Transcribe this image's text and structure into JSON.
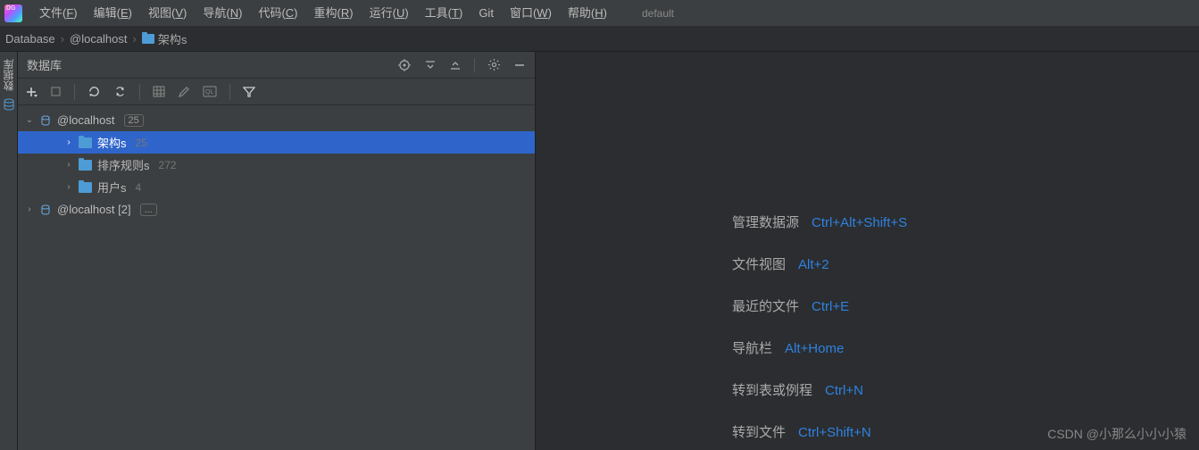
{
  "app": {
    "icon_label": "DG"
  },
  "menu": [
    {
      "label": "文件",
      "key": "F"
    },
    {
      "label": "编辑",
      "key": "E"
    },
    {
      "label": "视图",
      "key": "V"
    },
    {
      "label": "导航",
      "key": "N"
    },
    {
      "label": "代码",
      "key": "C"
    },
    {
      "label": "重构",
      "key": "R"
    },
    {
      "label": "运行",
      "key": "U"
    },
    {
      "label": "工具",
      "key": "T"
    },
    {
      "label": "Git",
      "key": ""
    },
    {
      "label": "窗口",
      "key": "W"
    },
    {
      "label": "帮助",
      "key": "H"
    }
  ],
  "default_label": "default",
  "breadcrumb": {
    "root": "Database",
    "host": "@localhost",
    "folder": "架构s"
  },
  "side_tab": {
    "label": "数据库"
  },
  "panel": {
    "title": "数据库",
    "header_icons": [
      "target-icon",
      "expand-down-icon",
      "collapse-up-icon",
      "gear-icon",
      "minimize-icon"
    ],
    "toolbar_icons": [
      "add-icon",
      "stop-icon",
      "refresh-icon",
      "sync-icon",
      "table-icon",
      "edit-icon",
      "console-icon",
      "filter-icon"
    ]
  },
  "tree": [
    {
      "expanded": true,
      "depth": 0,
      "icon": "db",
      "label": "@localhost",
      "badge": "25"
    },
    {
      "expanded": false,
      "depth": 1,
      "icon": "folder",
      "label": "架构s",
      "count": "25",
      "selected": true
    },
    {
      "expanded": false,
      "depth": 1,
      "icon": "folder",
      "label": "排序规则s",
      "count": "272"
    },
    {
      "expanded": false,
      "depth": 1,
      "icon": "folder",
      "label": "用户s",
      "count": "4"
    },
    {
      "expanded": false,
      "depth": 0,
      "icon": "db",
      "label": "@localhost [2]",
      "ellipsis": "..."
    }
  ],
  "shortcuts": [
    {
      "label": "管理数据源",
      "key": "Ctrl+Alt+Shift+S"
    },
    {
      "label": "文件视图",
      "key": "Alt+2"
    },
    {
      "label": "最近的文件",
      "key": "Ctrl+E"
    },
    {
      "label": "导航栏",
      "key": "Alt+Home"
    },
    {
      "label": "转到表或例程",
      "key": "Ctrl+N"
    },
    {
      "label": "转到文件",
      "key": "Ctrl+Shift+N"
    }
  ],
  "watermark": "CSDN @小那么小小小猿"
}
